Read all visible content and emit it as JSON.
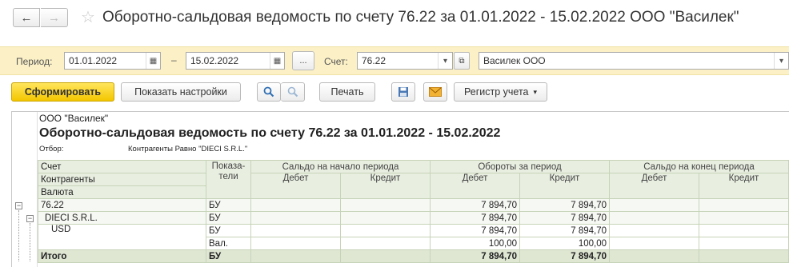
{
  "titlebar": {
    "back_icon": "←",
    "forward_icon": "→",
    "favorite_icon": "☆",
    "title": "Оборотно-сальдовая ведомость по счету 76.22 за 01.01.2022 - 15.02.2022 ООО \"Василек\""
  },
  "params": {
    "period_label": "Период:",
    "date_from": "01.01.2022",
    "dash": "–",
    "date_to": "15.02.2022",
    "ellipsis": "...",
    "account_label": "Счет:",
    "account": "76.22",
    "organization": "Василек ООО"
  },
  "toolbar": {
    "generate": "Сформировать",
    "show_settings": "Показать настройки",
    "print": "Печать",
    "register": "Регистр учета"
  },
  "report": {
    "org": "ООО \"Василек\"",
    "title": "Оборотно-сальдовая ведомость по счету 76.22 за 01.01.2022 - 15.02.2022",
    "filter_label": "Отбор:",
    "filter_value": "Контрагенты Равно \"DIECI S.R.L.\"",
    "header": {
      "account": "Счет",
      "counterparties": "Контрагенты",
      "currency": "Валюта",
      "indicators": "Показа-\nтели",
      "opening": "Сальдо на начало периода",
      "turnover": "Обороты за период",
      "closing": "Сальдо на конец периода",
      "debit": "Дебет",
      "credit": "Кредит"
    },
    "rows": [
      {
        "name": "76.22",
        "ind": "БУ",
        "od": "",
        "oc": "",
        "td": "7 894,70",
        "tc": "7 894,70",
        "cd": "",
        "cc": ""
      },
      {
        "name": "DIECI S.R.L.",
        "ind": "БУ",
        "od": "",
        "oc": "",
        "td": "7 894,70",
        "tc": "7 894,70",
        "cd": "",
        "cc": ""
      },
      {
        "name": "USD",
        "ind": "БУ",
        "od": "",
        "oc": "",
        "td": "7 894,70",
        "tc": "7 894,70",
        "cd": "",
        "cc": ""
      },
      {
        "name": "",
        "ind": "Вал.",
        "od": "",
        "oc": "",
        "td": "100,00",
        "tc": "100,00",
        "cd": "",
        "cc": ""
      }
    ],
    "total": {
      "name": "Итого",
      "ind": "БУ",
      "td": "7 894,70",
      "tc": "7 894,70"
    }
  }
}
